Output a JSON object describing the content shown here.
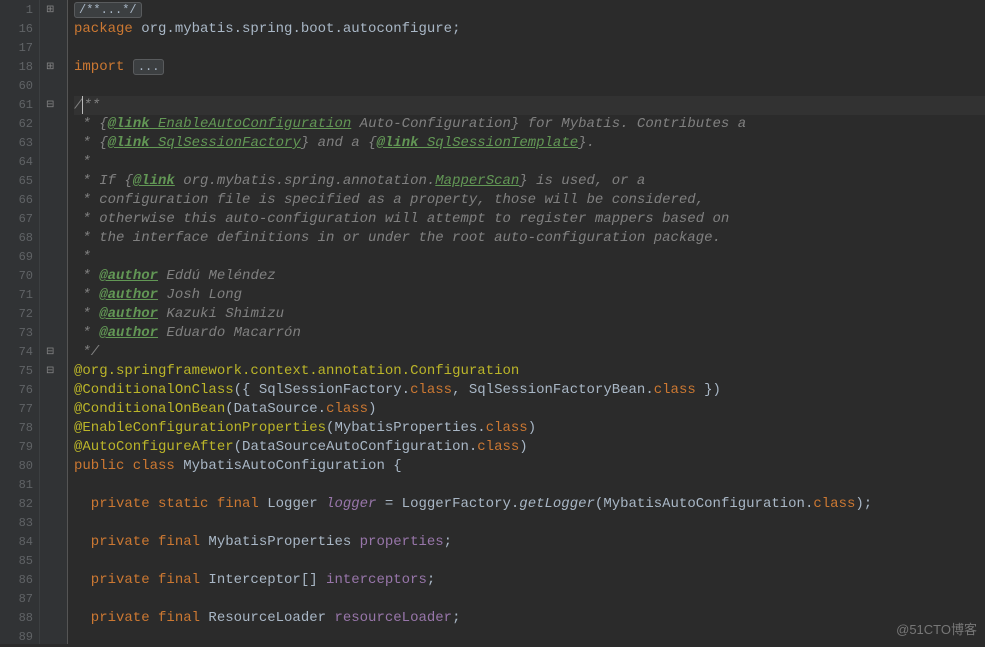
{
  "watermark": "@51CTO博客",
  "gutter": {
    "start_nums_a": [
      "1",
      "16",
      "17",
      "18",
      "60",
      "61",
      "62",
      "63",
      "64",
      "65",
      "66",
      "67",
      "68",
      "69",
      "70",
      "71",
      "72",
      "73",
      "74",
      "75",
      "76",
      "77",
      "78",
      "79",
      "80",
      "81",
      "82",
      "83",
      "84",
      "85",
      "86",
      "87",
      "88",
      "89"
    ]
  },
  "fold_icons": [
    {
      "row": 0,
      "glyph": "⊞"
    },
    {
      "row": 3,
      "glyph": "⊞"
    },
    {
      "row": 5,
      "glyph": "⊟"
    },
    {
      "row": 18,
      "glyph": "⊟"
    },
    {
      "row": 19,
      "glyph": "⊟"
    }
  ],
  "code": {
    "l0": "/**...*/",
    "l1_kw": "package",
    "l1_rest": " org.mybatis.spring.boot.autoconfigure;",
    "l3_kw": "import",
    "l3_fold": "...",
    "l5": "/**",
    "l6a": " * {",
    "l6b": "@link",
    "l6c": " EnableAutoConfiguration",
    "l6d": " Auto-Configuration} for Mybatis. Contributes a",
    "l7a": " * {",
    "l7b": "@link",
    "l7c": " SqlSessionFactory",
    "l7d": "} and a {",
    "l7e": "@link",
    "l7f": " SqlSessionTemplate",
    "l7g": "}.",
    "l8": " *",
    "l9a": " * If {",
    "l9b": "@link",
    "l9c": " org.mybatis.spring.annotation.",
    "l9d": "MapperScan",
    "l9e": "} is used, or a",
    "l10": " * configuration file is specified as a property, those will be considered,",
    "l11": " * otherwise this auto-configuration will attempt to register mappers based on",
    "l12": " * the interface definitions in or under the root auto-configuration package.",
    "l13": " *",
    "l14a": " * ",
    "l14b": "@author",
    "l14c": " Eddú Meléndez",
    "l15a": " * ",
    "l15b": "@author",
    "l15c": " Josh Long",
    "l16a": " * ",
    "l16b": "@author",
    "l16c": " Kazuki Shimizu",
    "l17a": " * ",
    "l17b": "@author",
    "l17c": " Eduardo Macarrón",
    "l18": " */",
    "l19": "@org.springframework.context.annotation.",
    "l19b": "Configuration",
    "l20a": "@ConditionalOnClass",
    "l20b": "({ SqlSessionFactory.",
    "l20c": "class",
    "l20d": ", SqlSessionFactoryBean.",
    "l20e": "class",
    "l20f": " })",
    "l21a": "@ConditionalOnBean",
    "l21b": "(DataSource.",
    "l21c": "class",
    "l21d": ")",
    "l22a": "@EnableConfigurationProperties",
    "l22b": "(MybatisProperties.",
    "l22c": "class",
    "l22d": ")",
    "l23a": "@AutoConfigureAfter",
    "l23b": "(DataSourceAutoConfiguration.",
    "l23c": "class",
    "l23d": ")",
    "l24a": "public class ",
    "l24b": "MybatisAutoConfiguration {",
    "l26a": "  private static final ",
    "l26b": "Logger ",
    "l26c": "logger",
    "l26d": " = LoggerFactory.",
    "l26e": "getLogger",
    "l26f": "(MybatisAutoConfiguration.",
    "l26g": "class",
    "l26h": ");",
    "l28a": "  private final ",
    "l28b": "MybatisProperties ",
    "l28c": "properties",
    "l28d": ";",
    "l30a": "  private final ",
    "l30b": "Interceptor[] ",
    "l30c": "interceptors",
    "l30d": ";",
    "l32a": "  private final ",
    "l32b": "ResourceLoader ",
    "l32c": "resourceLoader",
    "l32d": ";"
  }
}
